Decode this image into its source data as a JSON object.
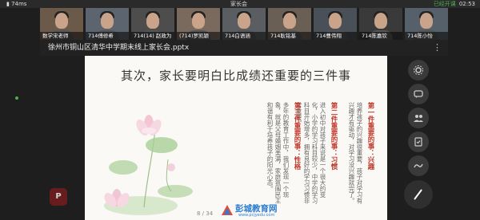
{
  "status": {
    "network": "74ms",
    "meeting_title": "家长会",
    "recording": "已经开课",
    "clock": "02:53"
  },
  "participants": [
    {
      "name": "数学宋老师",
      "bg": "#6b5a4a"
    },
    {
      "name": "714傅修希",
      "bg": "#5c6470"
    },
    {
      "name": "714(14)  赵政为",
      "bg": "#4d4d4d"
    },
    {
      "name": "(714)罗凯颖",
      "bg": "#7a6a5e"
    },
    {
      "name": "714白语涵",
      "bg": "#5a5e62"
    },
    {
      "name": "714耿铭基",
      "bg": "#6a5f55"
    },
    {
      "name": "714曹伟翔",
      "bg": "#4a5058"
    },
    {
      "name": "714陈嘉钦",
      "bg": "#3a3a3a"
    },
    {
      "name": "714陈小怡",
      "bg": "#55606a"
    }
  ],
  "presentation": {
    "file_name": "徐州市铜山区清华中学期末线上家长会.pptx",
    "more_label": "⋮",
    "slide_title": "其次，家长要明白比成绩还重要的三件事",
    "columns": [
      {
        "kind": "head",
        "text": "第一件重要的事：兴趣"
      },
      {
        "kind": "body",
        "text": "培养孩子的兴趣很重要，孩子对学习有兴趣才有驱动，对学习没兴趣就完了。"
      },
      {
        "kind": "head",
        "text": "第二件重要的事：习惯"
      },
      {
        "kind": "body",
        "text": "进入初中对孩子来说是一个很大的变化，小学的学习科目较少，中学的学习科目开始增多，拥有良好的学习习惯非常重要。"
      },
      {
        "kind": "head",
        "text": "第三件重要的事：性格"
      },
      {
        "kind": "body",
        "text": "多年的教育工作中，我们发现一个现象，就是父母婚姻美满，家庭氛围民主和谐有利于培养孩子的阳光心态。"
      }
    ],
    "page_indicator": "8 / 34"
  },
  "watermark": {
    "brand": "彭城教育网",
    "url": "www.pcjyedu.com"
  },
  "app_badge": "P",
  "tools": [
    "settings-icon",
    "chat-icon",
    "members-icon",
    "vote-icon",
    "draw-icon"
  ]
}
